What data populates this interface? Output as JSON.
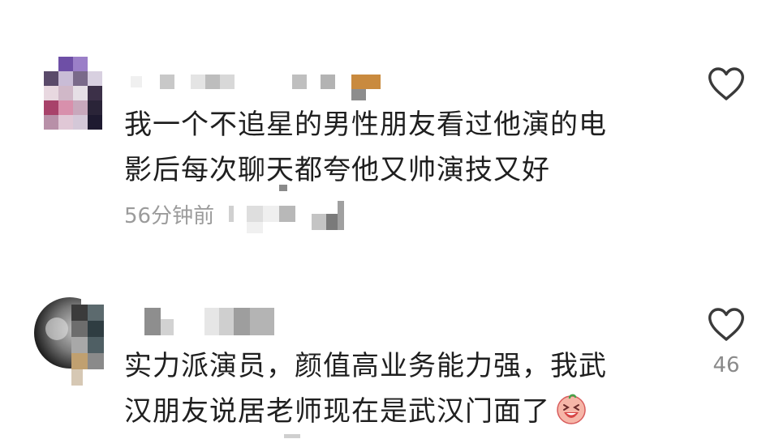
{
  "comments": [
    {
      "username": "",
      "content_line1": "我一个不追星的男性朋友看过他演的电",
      "content_line2": "影后每次聊天都夸他又帅演技又好",
      "time": "56分钟前",
      "like_count": "",
      "like_icon": "heart-outline-icon"
    },
    {
      "username": "",
      "content_line1": "实力派演员，颜值高业务能力强，我武",
      "content_line2": "汉朋友说居老师现在是武汉门面了",
      "time": "",
      "like_count": "46",
      "like_icon": "heart-outline-icon",
      "emoji": "laughing-face-emoji-icon"
    }
  ]
}
